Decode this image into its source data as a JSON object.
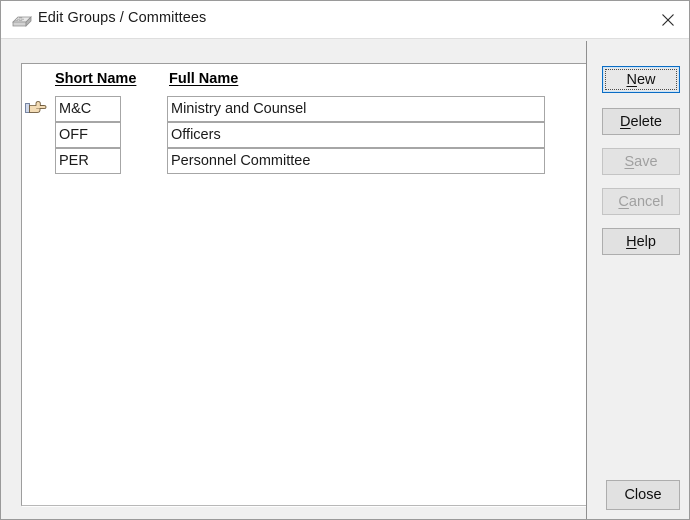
{
  "window": {
    "title": "Edit Groups / Committees",
    "icon": "card-file-icon",
    "close_icon": "close-icon"
  },
  "grid": {
    "columns": [
      {
        "key": "short_name",
        "label": "Short Name"
      },
      {
        "key": "full_name",
        "label": "Full Name"
      }
    ],
    "current_row_marker": "pointing-hand-icon",
    "rows": [
      {
        "short_name": "M&C",
        "full_name": "Ministry and Counsel",
        "current": true
      },
      {
        "short_name": "OFF",
        "full_name": "Officers",
        "current": false
      },
      {
        "short_name": "PER",
        "full_name": "Personnel Committee",
        "current": false
      }
    ]
  },
  "buttons": {
    "new": {
      "pre": "",
      "mnemonic": "N",
      "post": "ew",
      "state": "focused"
    },
    "delete": {
      "pre": "",
      "mnemonic": "D",
      "post": "elete",
      "state": "enabled"
    },
    "save": {
      "pre": "",
      "mnemonic": "S",
      "post": "ave",
      "state": "disabled"
    },
    "cancel": {
      "pre": "",
      "mnemonic": "C",
      "post": "ancel",
      "state": "disabled"
    },
    "help": {
      "pre": "",
      "mnemonic": "H",
      "post": "elp",
      "state": "enabled"
    },
    "close": {
      "label": "Close",
      "state": "enabled"
    }
  },
  "colors": {
    "window_bg": "#f0f0f0",
    "titlebar_bg": "#ffffff",
    "panel_bg": "#ffffff",
    "button_face": "#e1e1e1",
    "focus_border": "#0a6cc4",
    "text": "#1a1a1a",
    "disabled_text": "#a0a0a0"
  }
}
